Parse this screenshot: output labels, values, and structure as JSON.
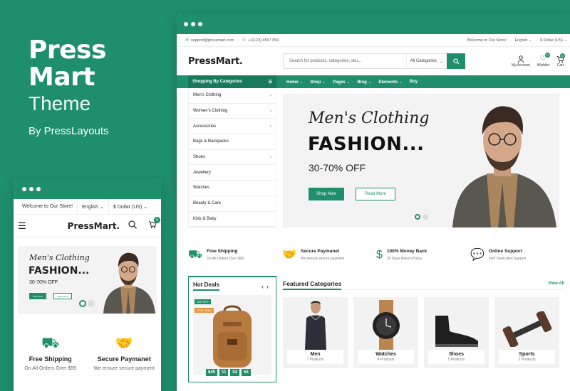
{
  "brand": {
    "name_line1": "Press",
    "name_line2": "Mart",
    "subtitle": "Theme",
    "by": "By PressLayouts"
  },
  "desktop": {
    "topbar": {
      "email": "support@pressmart.com",
      "phone": "+1(123) 4567 890",
      "welcome": "Welcome to Our Store!",
      "language": "English ⌄",
      "currency": "$ Dollar (US) ⌄"
    },
    "header": {
      "logo": "PressMart.",
      "search_placeholder": "Search for products, categories, sku...",
      "search_category": "All Categories",
      "account": "My Account",
      "wishlist": "Wishlist",
      "wishlist_count": "0",
      "cart": "Cart",
      "cart_count": "0"
    },
    "nav": {
      "categories_label": "Shopping By Categories",
      "items": [
        "Home",
        "Shop",
        "Pages",
        "Blog",
        "Elements",
        "Buy"
      ]
    },
    "categories": [
      "Men's Clothing",
      "Women's Clothing",
      "Accessories",
      "Bags & Backpacks",
      "Shoes",
      "Jewellery",
      "Watches",
      "Beauty & Care",
      "Kids & Baby"
    ],
    "hero": {
      "script": "Men's Clothing",
      "title": "FASHION...",
      "subtitle": "30-70% OFF",
      "shop_now": "Shop Now",
      "read_more": "Read More"
    },
    "features": [
      {
        "icon": "truck-icon",
        "title": "Free Shipping",
        "sub": "On All Orders Over $99"
      },
      {
        "icon": "handshake-icon",
        "title": "Secure Paymanet",
        "sub": "We ensure secure payment"
      },
      {
        "icon": "money-back-icon",
        "title": "100% Money Back",
        "sub": "30 Days Return Policy"
      },
      {
        "icon": "chat-icon",
        "title": "Online Support",
        "sub": "24/7 Dedicated Support"
      }
    ],
    "hot_deals": {
      "title": "Hot Deals",
      "tag_off": "15% OFF",
      "tag_featured": "FEATURED",
      "timer": [
        "845",
        "11",
        "02",
        "53"
      ]
    },
    "featured_categories": {
      "title": "Featured Categories",
      "view_all": "View All",
      "items": [
        {
          "name": "Men",
          "count": "7 Products"
        },
        {
          "name": "Watches",
          "count": "4 Products"
        },
        {
          "name": "Shoes",
          "count": "5 Products"
        },
        {
          "name": "Sports",
          "count": "2 Products"
        }
      ]
    }
  },
  "mobile": {
    "topbar": {
      "welcome": "Welcome to Our Store!",
      "language": "English ⌄",
      "currency": "$ Dollar (US) ⌄"
    },
    "logo": "PressMart.",
    "cart_count": "0",
    "hero": {
      "script": "Men's Clothing",
      "title": "FASHION...",
      "subtitle": "30-70% OFF",
      "shop_now": "Shop Now",
      "read_more": "Read More"
    },
    "features": [
      {
        "title": "Free Shipping",
        "sub": "On All Orders Over $99"
      },
      {
        "title": "Secure Paymanet",
        "sub": "We ensure secure payment"
      }
    ]
  },
  "colors": {
    "brand_green": "#1f8f6b",
    "accent_orange": "#e8963c"
  }
}
